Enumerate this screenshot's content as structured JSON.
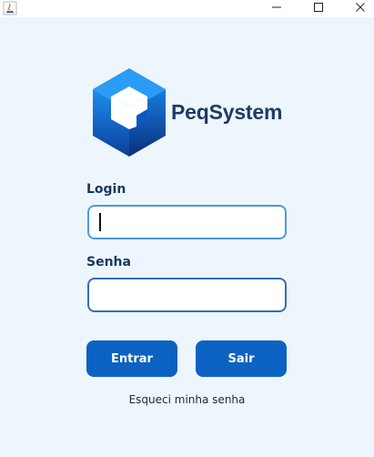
{
  "window": {
    "minimize_icon": "minimize-icon",
    "maximize_icon": "maximize-icon",
    "close_icon": "close-icon"
  },
  "logo": {
    "text": "PeqSystem",
    "icon": "hexagon-cube-logo"
  },
  "form": {
    "login_label": "Login",
    "login_value": "",
    "senha_label": "Senha",
    "senha_value": ""
  },
  "buttons": {
    "entrar": "Entrar",
    "sair": "Sair"
  },
  "links": {
    "forgot_password": "Esqueci minha senha"
  },
  "colors": {
    "background": "#eef6fd",
    "primary": "#0c62c2",
    "label": "#15385e",
    "logo_text": "#1f3b66"
  }
}
